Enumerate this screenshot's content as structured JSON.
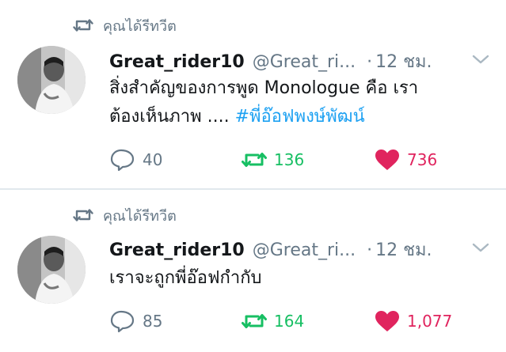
{
  "tweets": [
    {
      "context": "คุณได้รีทวีต",
      "display_name": "Great_rider10",
      "handle": "@Great_ri...",
      "separator": "·",
      "time": "12 ชม.",
      "text_line1": "สิ่งสำคัญของการพูด Monologue คือ เรา",
      "text_line2_plain": "ต้องเห็นภาพ .... ",
      "hashtag": "#พี่อ๊อฟพงษ์พัฒน์",
      "replies": "40",
      "retweets": "136",
      "likes": "736"
    },
    {
      "context": "คุณได้รีทวีต",
      "display_name": "Great_rider10",
      "handle": "@Great_ri...",
      "separator": "·",
      "time": "12 ชม.",
      "text_line1": "เราจะถูกพี่อ๊อฟกำกับ",
      "replies": "85",
      "retweets": "164",
      "likes": "1,077"
    }
  ],
  "colors": {
    "retweet_green": "#17bf63",
    "like_red": "#e0245e",
    "hashtag_blue": "#1da1f2",
    "muted_gray": "#657786"
  },
  "icons": {
    "context": "retweet-icon",
    "reply": "reply-icon",
    "retweet": "retweet-icon",
    "like": "heart-icon",
    "caret": "chevron-down-icon"
  }
}
